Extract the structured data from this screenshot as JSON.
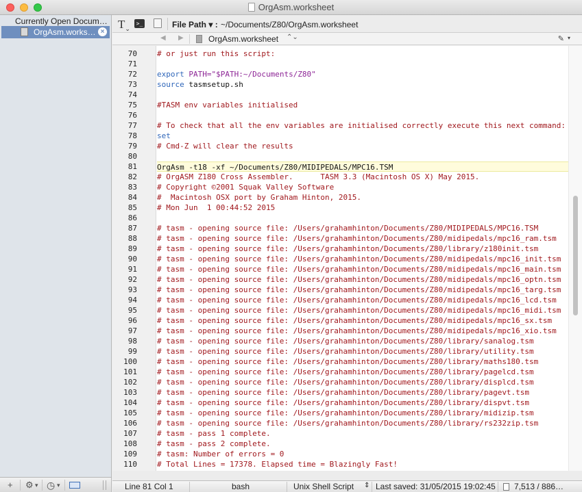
{
  "window": {
    "title": "OrgAsm.worksheet"
  },
  "sidebar": {
    "header": "Currently Open Docum…",
    "items": [
      {
        "label": "OrgAsm.works…",
        "close": "×"
      }
    ],
    "footer": {
      "add": "+",
      "gear": "⚙",
      "gear_menu": "▾",
      "clock": "◷",
      "clock_menu": "▾"
    }
  },
  "toolbar": {
    "text_tool": "T",
    "text_tool_menu": "⌄",
    "terminal": ">_",
    "file_path_label": "File Path ▾ :",
    "file_path_value": "~/Documents/Z80/OrgAsm.worksheet"
  },
  "jumpbar": {
    "back": "◀",
    "forward": "▶",
    "doc_name": "OrgAsm.worksheet",
    "updown": "⌃⌄",
    "pin": "✎",
    "menu": "▾"
  },
  "editor": {
    "current_line": 81,
    "lines": [
      {
        "n": "70",
        "segments": [
          {
            "t": "# or just run this script:",
            "c": "comment"
          }
        ]
      },
      {
        "n": "71",
        "segments": []
      },
      {
        "n": "72",
        "segments": [
          {
            "t": "export",
            "c": "kw"
          },
          {
            "t": " PATH=\"$PATH:~/Documents/Z80\"",
            "c": "str"
          }
        ]
      },
      {
        "n": "73",
        "segments": [
          {
            "t": "source",
            "c": "kw"
          },
          {
            "t": " tasmsetup.sh",
            "c": "plain"
          }
        ]
      },
      {
        "n": "74",
        "segments": []
      },
      {
        "n": "75",
        "segments": [
          {
            "t": "#TASM env variables initialised",
            "c": "comment"
          }
        ]
      },
      {
        "n": "76",
        "segments": []
      },
      {
        "n": "77",
        "segments": [
          {
            "t": "# To check that all the env variables are initialised correctly execute this next command:",
            "c": "comment"
          }
        ]
      },
      {
        "n": "78",
        "segments": [
          {
            "t": "set",
            "c": "kw"
          }
        ]
      },
      {
        "n": "79",
        "segments": [
          {
            "t": "# Cmd-Z will clear the results",
            "c": "comment"
          }
        ]
      },
      {
        "n": "80",
        "segments": []
      },
      {
        "n": "81",
        "segments": [
          {
            "t": "OrgAsm -t18 -xf ~/Documents/Z80/MIDIPEDALS/MPC16.TSM",
            "c": "plain"
          }
        ]
      },
      {
        "n": "82",
        "segments": [
          {
            "t": "# OrgASM Z180 Cross Assembler.      TASM 3.3 (Macintosh OS X) May 2015.",
            "c": "comment"
          }
        ]
      },
      {
        "n": "83",
        "segments": [
          {
            "t": "# Copyright ©2001 Squak Valley Software",
            "c": "comment"
          }
        ]
      },
      {
        "n": "84",
        "segments": [
          {
            "t": "#  Macintosh OSX port by Graham Hinton, 2015.",
            "c": "comment"
          }
        ]
      },
      {
        "n": "85",
        "segments": [
          {
            "t": "# Mon Jun  1 00:44:52 2015",
            "c": "comment"
          }
        ]
      },
      {
        "n": "86",
        "segments": []
      },
      {
        "n": "87",
        "segments": [
          {
            "t": "# tasm - opening source file: /Users/grahamhinton/Documents/Z80/MIDIPEDALS/MPC16.TSM",
            "c": "comment"
          }
        ]
      },
      {
        "n": "88",
        "segments": [
          {
            "t": "# tasm - opening source file: /Users/grahamhinton/Documents/Z80/midipedals/mpc16_ram.tsm",
            "c": "comment"
          }
        ]
      },
      {
        "n": "89",
        "segments": [
          {
            "t": "# tasm - opening source file: /Users/grahamhinton/Documents/Z80/library/z180init.tsm",
            "c": "comment"
          }
        ]
      },
      {
        "n": "90",
        "segments": [
          {
            "t": "# tasm - opening source file: /Users/grahamhinton/Documents/Z80/midipedals/mpc16_init.tsm",
            "c": "comment"
          }
        ]
      },
      {
        "n": "91",
        "segments": [
          {
            "t": "# tasm - opening source file: /Users/grahamhinton/Documents/Z80/midipedals/mpc16_main.tsm",
            "c": "comment"
          }
        ]
      },
      {
        "n": "92",
        "segments": [
          {
            "t": "# tasm - opening source file: /Users/grahamhinton/Documents/Z80/midipedals/mpc16_optn.tsm",
            "c": "comment"
          }
        ]
      },
      {
        "n": "93",
        "segments": [
          {
            "t": "# tasm - opening source file: /Users/grahamhinton/Documents/Z80/midipedals/mpc16_targ.tsm",
            "c": "comment"
          }
        ]
      },
      {
        "n": "94",
        "segments": [
          {
            "t": "# tasm - opening source file: /Users/grahamhinton/Documents/Z80/midipedals/mpc16_lcd.tsm",
            "c": "comment"
          }
        ]
      },
      {
        "n": "95",
        "segments": [
          {
            "t": "# tasm - opening source file: /Users/grahamhinton/Documents/Z80/midipedals/mpc16_midi.tsm",
            "c": "comment"
          }
        ]
      },
      {
        "n": "96",
        "segments": [
          {
            "t": "# tasm - opening source file: /Users/grahamhinton/Documents/Z80/midipedals/mpc16_sx.tsm",
            "c": "comment"
          }
        ]
      },
      {
        "n": "97",
        "segments": [
          {
            "t": "# tasm - opening source file: /Users/grahamhinton/Documents/Z80/midipedals/mpc16_xio.tsm",
            "c": "comment"
          }
        ]
      },
      {
        "n": "98",
        "segments": [
          {
            "t": "# tasm - opening source file: /Users/grahamhinton/Documents/Z80/library/sanalog.tsm",
            "c": "comment"
          }
        ]
      },
      {
        "n": "99",
        "segments": [
          {
            "t": "# tasm - opening source file: /Users/grahamhinton/Documents/Z80/library/utility.tsm",
            "c": "comment"
          }
        ]
      },
      {
        "n": "100",
        "segments": [
          {
            "t": "# tasm - opening source file: /Users/grahamhinton/Documents/Z80/library/maths180.tsm",
            "c": "comment"
          }
        ]
      },
      {
        "n": "101",
        "segments": [
          {
            "t": "# tasm - opening source file: /Users/grahamhinton/Documents/Z80/library/pagelcd.tsm",
            "c": "comment"
          }
        ]
      },
      {
        "n": "102",
        "segments": [
          {
            "t": "# tasm - opening source file: /Users/grahamhinton/Documents/Z80/library/displcd.tsm",
            "c": "comment"
          }
        ]
      },
      {
        "n": "103",
        "segments": [
          {
            "t": "# tasm - opening source file: /Users/grahamhinton/Documents/Z80/library/pagevt.tsm",
            "c": "comment"
          }
        ]
      },
      {
        "n": "104",
        "segments": [
          {
            "t": "# tasm - opening source file: /Users/grahamhinton/Documents/Z80/library/dispvt.tsm",
            "c": "comment"
          }
        ]
      },
      {
        "n": "105",
        "segments": [
          {
            "t": "# tasm - opening source file: /Users/grahamhinton/Documents/Z80/library/midizip.tsm",
            "c": "comment"
          }
        ]
      },
      {
        "n": "106",
        "segments": [
          {
            "t": "# tasm - opening source file: /Users/grahamhinton/Documents/Z80/library/rs232zip.tsm",
            "c": "comment"
          }
        ]
      },
      {
        "n": "107",
        "segments": [
          {
            "t": "# tasm - pass 1 complete.",
            "c": "comment"
          }
        ]
      },
      {
        "n": "108",
        "segments": [
          {
            "t": "# tasm - pass 2 complete.",
            "c": "comment"
          }
        ]
      },
      {
        "n": "109",
        "segments": [
          {
            "t": "# tasm: Number of errors = 0",
            "c": "comment"
          }
        ]
      },
      {
        "n": "110",
        "segments": [
          {
            "t": "# Total Lines = 17378. Elapsed time = Blazingly Fast!",
            "c": "comment"
          }
        ]
      }
    ]
  },
  "statusbar": {
    "position": "Line 81 Col 1",
    "shell": "bash",
    "syntax": "Unix Shell Script",
    "syntax_menu": "⇕",
    "last_saved": "Last saved: 31/05/2015 19:02:45",
    "size": "7,513 / 886…"
  },
  "colors": {
    "comment": "#a0181d",
    "keyword": "#2f66b9",
    "string": "#8d2596",
    "sidebar_selection": "#6f8fbf",
    "current_line": "#fffcdc"
  }
}
